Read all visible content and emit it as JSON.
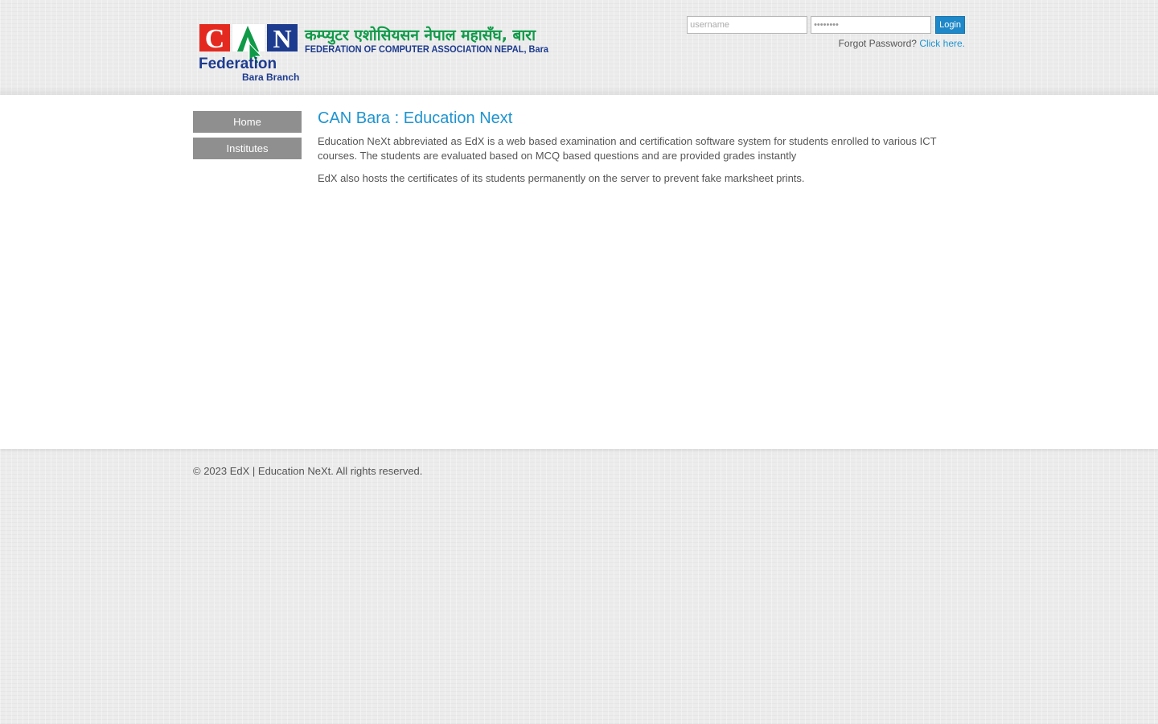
{
  "header": {
    "logo": {
      "letters": [
        "C",
        "N"
      ],
      "federation": "Federation",
      "branch": "Bara Branch",
      "nepali_title": "कम्प्युटर एशोसियसन नेपाल महासँघ, बारा",
      "english_title": "FEDERATION OF COMPUTER ASSOCIATION NEPAL, Bara"
    },
    "login": {
      "username_placeholder": "username",
      "password_value": "password",
      "button_label": "Login",
      "forgot_text": "Forgot Password?",
      "forgot_link": "Click here."
    }
  },
  "sidebar": {
    "items": [
      {
        "label": "Home"
      },
      {
        "label": "Institutes"
      }
    ]
  },
  "content": {
    "title": "CAN Bara : Education Next",
    "paragraphs": [
      "Education NeXt abbreviated as EdX is a web based examination and certification software system for students enrolled to various ICT courses. The students are evaluated based on MCQ based questions and are provided grades instantly",
      "EdX also hosts the certificates of its students permanently on the server to prevent fake marksheet prints."
    ]
  },
  "footer": {
    "copyright": "© 2023 EdX | Education NeXt. All rights reserved."
  },
  "colors": {
    "accent": "#1e94d0",
    "button": "#1e88c8",
    "nav_bg": "#8f8f8f",
    "logo_red": "#e42a20",
    "logo_blue": "#1d3b8f",
    "logo_green": "#0f9a48"
  }
}
